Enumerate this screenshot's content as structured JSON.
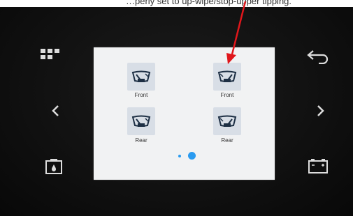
{
  "top_caption": "…perly set to up-wipe/stop-upper tipping.",
  "accent_color": "#2a9bf0",
  "annotation_color": "#e0161b",
  "screen": {
    "tiles": [
      {
        "label": "Front",
        "icon": "wiper-front-icon"
      },
      {
        "label": "Front",
        "icon": "wiper-front-icon"
      },
      {
        "label": "Rear",
        "icon": "wiper-rear-icon"
      },
      {
        "label": "Rear",
        "icon": "wiper-rear-icon"
      }
    ],
    "pages": {
      "count": 2,
      "current": 2
    }
  },
  "left_buttons": [
    {
      "icon": "grid-menu-icon"
    },
    {
      "icon": "chevron-left-icon"
    },
    {
      "icon": "washer-fluid-icon"
    }
  ],
  "right_buttons": [
    {
      "icon": "back-arrow-icon"
    },
    {
      "icon": "chevron-right-icon"
    },
    {
      "icon": "battery-icon"
    }
  ]
}
